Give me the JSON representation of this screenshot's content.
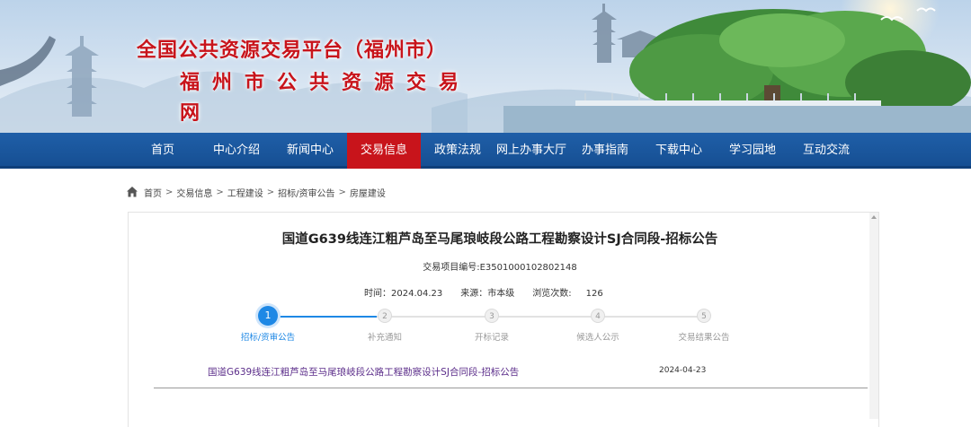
{
  "site": {
    "title_line1": "全国公共资源交易平台（福州市）",
    "title_line2": "福州市公共资源交易网"
  },
  "nav": {
    "items": [
      {
        "label": "首页",
        "active": false
      },
      {
        "label": "中心介绍",
        "active": false
      },
      {
        "label": "新闻中心",
        "active": false
      },
      {
        "label": "交易信息",
        "active": true
      },
      {
        "label": "政策法规",
        "active": false
      },
      {
        "label": "网上办事大厅",
        "active": false
      },
      {
        "label": "办事指南",
        "active": false
      },
      {
        "label": "下载中心",
        "active": false
      },
      {
        "label": "学习园地",
        "active": false
      },
      {
        "label": "互动交流",
        "active": false
      }
    ]
  },
  "breadcrumb": {
    "icon": "home-icon",
    "items": [
      "首页",
      "交易信息",
      "工程建设",
      "招标/资审公告",
      "房屋建设"
    ],
    "separator": ">"
  },
  "announcement": {
    "title": "国道G639线连江粗芦岛至马尾琅岐段公路工程勘察设计SJ合同段-招标公告",
    "project_no": "交易项目编号:E3501000102802148",
    "time_label": "时间：",
    "time_value": "2024.04.23",
    "source_label": "来源：",
    "source_value": "市本级",
    "views_label": "浏览次数:",
    "views_value": "126"
  },
  "stepper": {
    "steps": [
      {
        "num": "1",
        "label": "招标/资审公告",
        "active": true
      },
      {
        "num": "2",
        "label": "补充通知",
        "active": false
      },
      {
        "num": "3",
        "label": "开标记录",
        "active": false
      },
      {
        "num": "4",
        "label": "候选人公示",
        "active": false
      },
      {
        "num": "5",
        "label": "交易结果公告",
        "active": false
      }
    ],
    "active_color": "#1e88e5"
  },
  "list": {
    "rows": [
      {
        "title": "国道G639线连江粗芦岛至马尾琅岐段公路工程勘察设计SJ合同段-招标公告",
        "date": "2024-04-23"
      }
    ]
  },
  "colors": {
    "brand_red": "#c8141b",
    "nav_blue": "#1a579e",
    "link_purple": "#5b2d8a"
  }
}
